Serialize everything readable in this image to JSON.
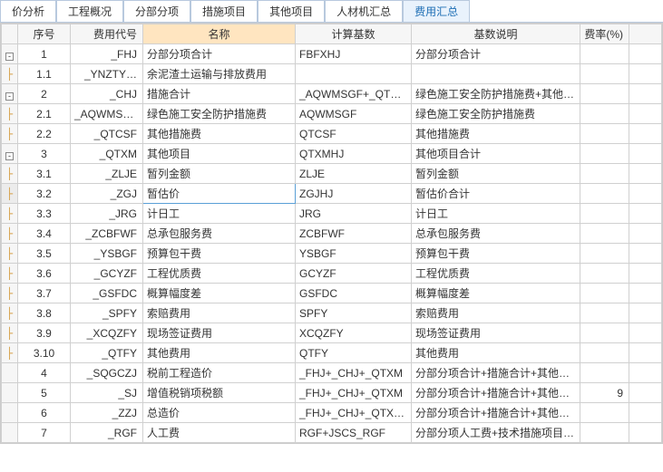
{
  "tabs": [
    {
      "label": "价分析",
      "active": false
    },
    {
      "label": "工程概况",
      "active": false
    },
    {
      "label": "分部分项",
      "active": false
    },
    {
      "label": "措施项目",
      "active": false
    },
    {
      "label": "其他项目",
      "active": false
    },
    {
      "label": "人材机汇总",
      "active": false
    },
    {
      "label": "费用汇总",
      "active": true
    }
  ],
  "columns": {
    "idx": "序号",
    "code": "费用代号",
    "name": "名称",
    "base": "计算基数",
    "desc": "基数说明",
    "rate": "费率(%)"
  },
  "rows": [
    {
      "tree": "minus",
      "idx": "1",
      "code": "_FHJ",
      "name": "分部分项合计",
      "base": "FBFXHJ",
      "desc": "分部分项合计",
      "rate": ""
    },
    {
      "tree": "branch",
      "idx": "1.1",
      "code": "_YNZTY…",
      "name": "余泥渣土运输与排放费用",
      "base": "",
      "desc": "",
      "rate": ""
    },
    {
      "tree": "minus",
      "idx": "2",
      "code": "_CHJ",
      "name": "措施合计",
      "base": "_AQWMSGF+_QTCSF",
      "desc": "绿色施工安全防护措施费+其他措施费",
      "rate": ""
    },
    {
      "tree": "branch",
      "idx": "2.1",
      "code": "_AQWMSGF",
      "name": "绿色施工安全防护措施费",
      "base": "AQWMSGF",
      "desc": "绿色施工安全防护措施费",
      "rate": ""
    },
    {
      "tree": "branch",
      "idx": "2.2",
      "code": "_QTCSF",
      "name": "其他措施费",
      "base": "QTCSF",
      "desc": "其他措施费",
      "rate": ""
    },
    {
      "tree": "minus",
      "idx": "3",
      "code": "_QTXM",
      "name": "其他项目",
      "base": "QTXMHJ",
      "desc": "其他项目合计",
      "rate": ""
    },
    {
      "tree": "branch",
      "idx": "3.1",
      "code": "_ZLJE",
      "name": "暂列金额",
      "base": "ZLJE",
      "desc": "暂列金额",
      "rate": ""
    },
    {
      "tree": "branch",
      "idx": "3.2",
      "code": "_ZGJ",
      "name": "暂估价",
      "base": "ZGJHJ",
      "desc": "暂估价合计",
      "rate": "",
      "sel": true
    },
    {
      "tree": "branch",
      "idx": "3.3",
      "code": "_JRG",
      "name": "计日工",
      "base": "JRG",
      "desc": "计日工",
      "rate": ""
    },
    {
      "tree": "branch",
      "idx": "3.4",
      "code": "_ZCBFWF",
      "name": "总承包服务费",
      "base": "ZCBFWF",
      "desc": "总承包服务费",
      "rate": ""
    },
    {
      "tree": "branch",
      "idx": "3.5",
      "code": "_YSBGF",
      "name": "预算包干费",
      "base": "YSBGF",
      "desc": "预算包干费",
      "rate": ""
    },
    {
      "tree": "branch",
      "idx": "3.6",
      "code": "_GCYZF",
      "name": "工程优质费",
      "base": "GCYZF",
      "desc": "工程优质费",
      "rate": ""
    },
    {
      "tree": "branch",
      "idx": "3.7",
      "code": "_GSFDC",
      "name": "概算幅度差",
      "base": "GSFDC",
      "desc": "概算幅度差",
      "rate": ""
    },
    {
      "tree": "branch",
      "idx": "3.8",
      "code": "_SPFY",
      "name": "索赔费用",
      "base": "SPFY",
      "desc": "索赔费用",
      "rate": ""
    },
    {
      "tree": "branch",
      "idx": "3.9",
      "code": "_XCQZFY",
      "name": "现场签证费用",
      "base": "XCQZFY",
      "desc": "现场签证费用",
      "rate": ""
    },
    {
      "tree": "branch",
      "idx": "3.10",
      "code": "_QTFY",
      "name": "其他费用",
      "base": "QTFY",
      "desc": "其他费用",
      "rate": ""
    },
    {
      "tree": "",
      "idx": "4",
      "code": "_SQGCZJ",
      "name": "税前工程造价",
      "base": "_FHJ+_CHJ+_QTXM",
      "desc": "分部分项合计+措施合计+其他项目",
      "rate": ""
    },
    {
      "tree": "",
      "idx": "5",
      "code": "_SJ",
      "name": "增值税销项税额",
      "base": "_FHJ+_CHJ+_QTXM",
      "desc": "分部分项合计+措施合计+其他项目",
      "rate": "9"
    },
    {
      "tree": "",
      "idx": "6",
      "code": "_ZZJ",
      "name": "总造价",
      "base": "_FHJ+_CHJ+_QTXM+_SJ",
      "desc": "分部分项合计+措施合计+其他项目+增值税销项税额",
      "rate": ""
    },
    {
      "tree": "",
      "idx": "7",
      "code": "_RGF",
      "name": "人工费",
      "base": "RGF+JSCS_RGF",
      "desc": "分部分项人工费+技术措施项目人工费",
      "rate": ""
    }
  ]
}
